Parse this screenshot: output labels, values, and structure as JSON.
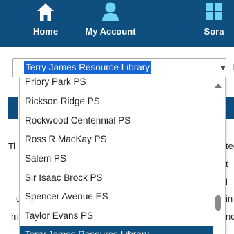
{
  "nav": {
    "home": {
      "label": "Home",
      "icon": "home-icon"
    },
    "account": {
      "label": "My Account",
      "icon": "user-icon"
    },
    "sora": {
      "label": "Sora",
      "icon": "grid-icon"
    }
  },
  "colors": {
    "navy": "#0f4f80",
    "selection": "#1a66d2"
  },
  "library_select": {
    "selected": "Terry James Resource Library",
    "trail_char": "I"
  },
  "dropdown": {
    "options": [
      "Priory Park PS",
      "Rickson Ridge PS",
      "Rockwood Centennial PS",
      "Ross R MacKay PS",
      "Salem PS",
      "Sir Isaac Brock PS",
      "Spencer Avenue ES",
      "Taylor Evans PS",
      "Terry James Resource Library"
    ],
    "highlighted_index": 8
  },
  "background_fragments": {
    "left_1": "Tl",
    "left_2": "c",
    "left_3": "hi",
    "right_1": "ted",
    "right_2": "t",
    "right_3": "l",
    "right_4": "in",
    "right_5": "nc"
  }
}
